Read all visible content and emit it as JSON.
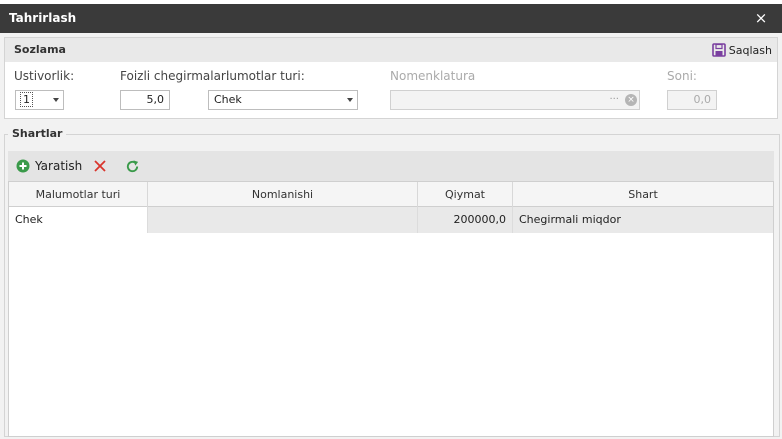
{
  "window": {
    "title": "Tahrirlash",
    "close_glyph": "×"
  },
  "settings": {
    "group_title": "Sozlama",
    "save_label": "Saqlash",
    "priority": {
      "label": "Ustivorlik:",
      "value": "1"
    },
    "discount": {
      "label": "Foizli chegirmalar:",
      "value": "5,0"
    },
    "info_type": {
      "label": "lumotlar turi:",
      "value": "Chek"
    },
    "nomenclature": {
      "label": "Nomenklatura",
      "value": "",
      "dots": "···"
    },
    "quantity": {
      "label": "Soni:",
      "value": "0,0"
    }
  },
  "conditions": {
    "group_title": "Shartlar",
    "create_label": "Yaratish",
    "columns": [
      "Malumotlar turi",
      "Nomlanishi",
      "Qiymat",
      "Shart"
    ],
    "rows": [
      {
        "type": "Chek",
        "name": "",
        "value": "200000,0",
        "condition": "Chegirmali miqdor"
      }
    ]
  },
  "colors": {
    "titlebar": "#3a3a3a",
    "add_green": "#3a9a4a",
    "delete_red": "#d9342b",
    "refresh_green": "#3a9a4a",
    "save_purple": "#7a3fa0"
  }
}
